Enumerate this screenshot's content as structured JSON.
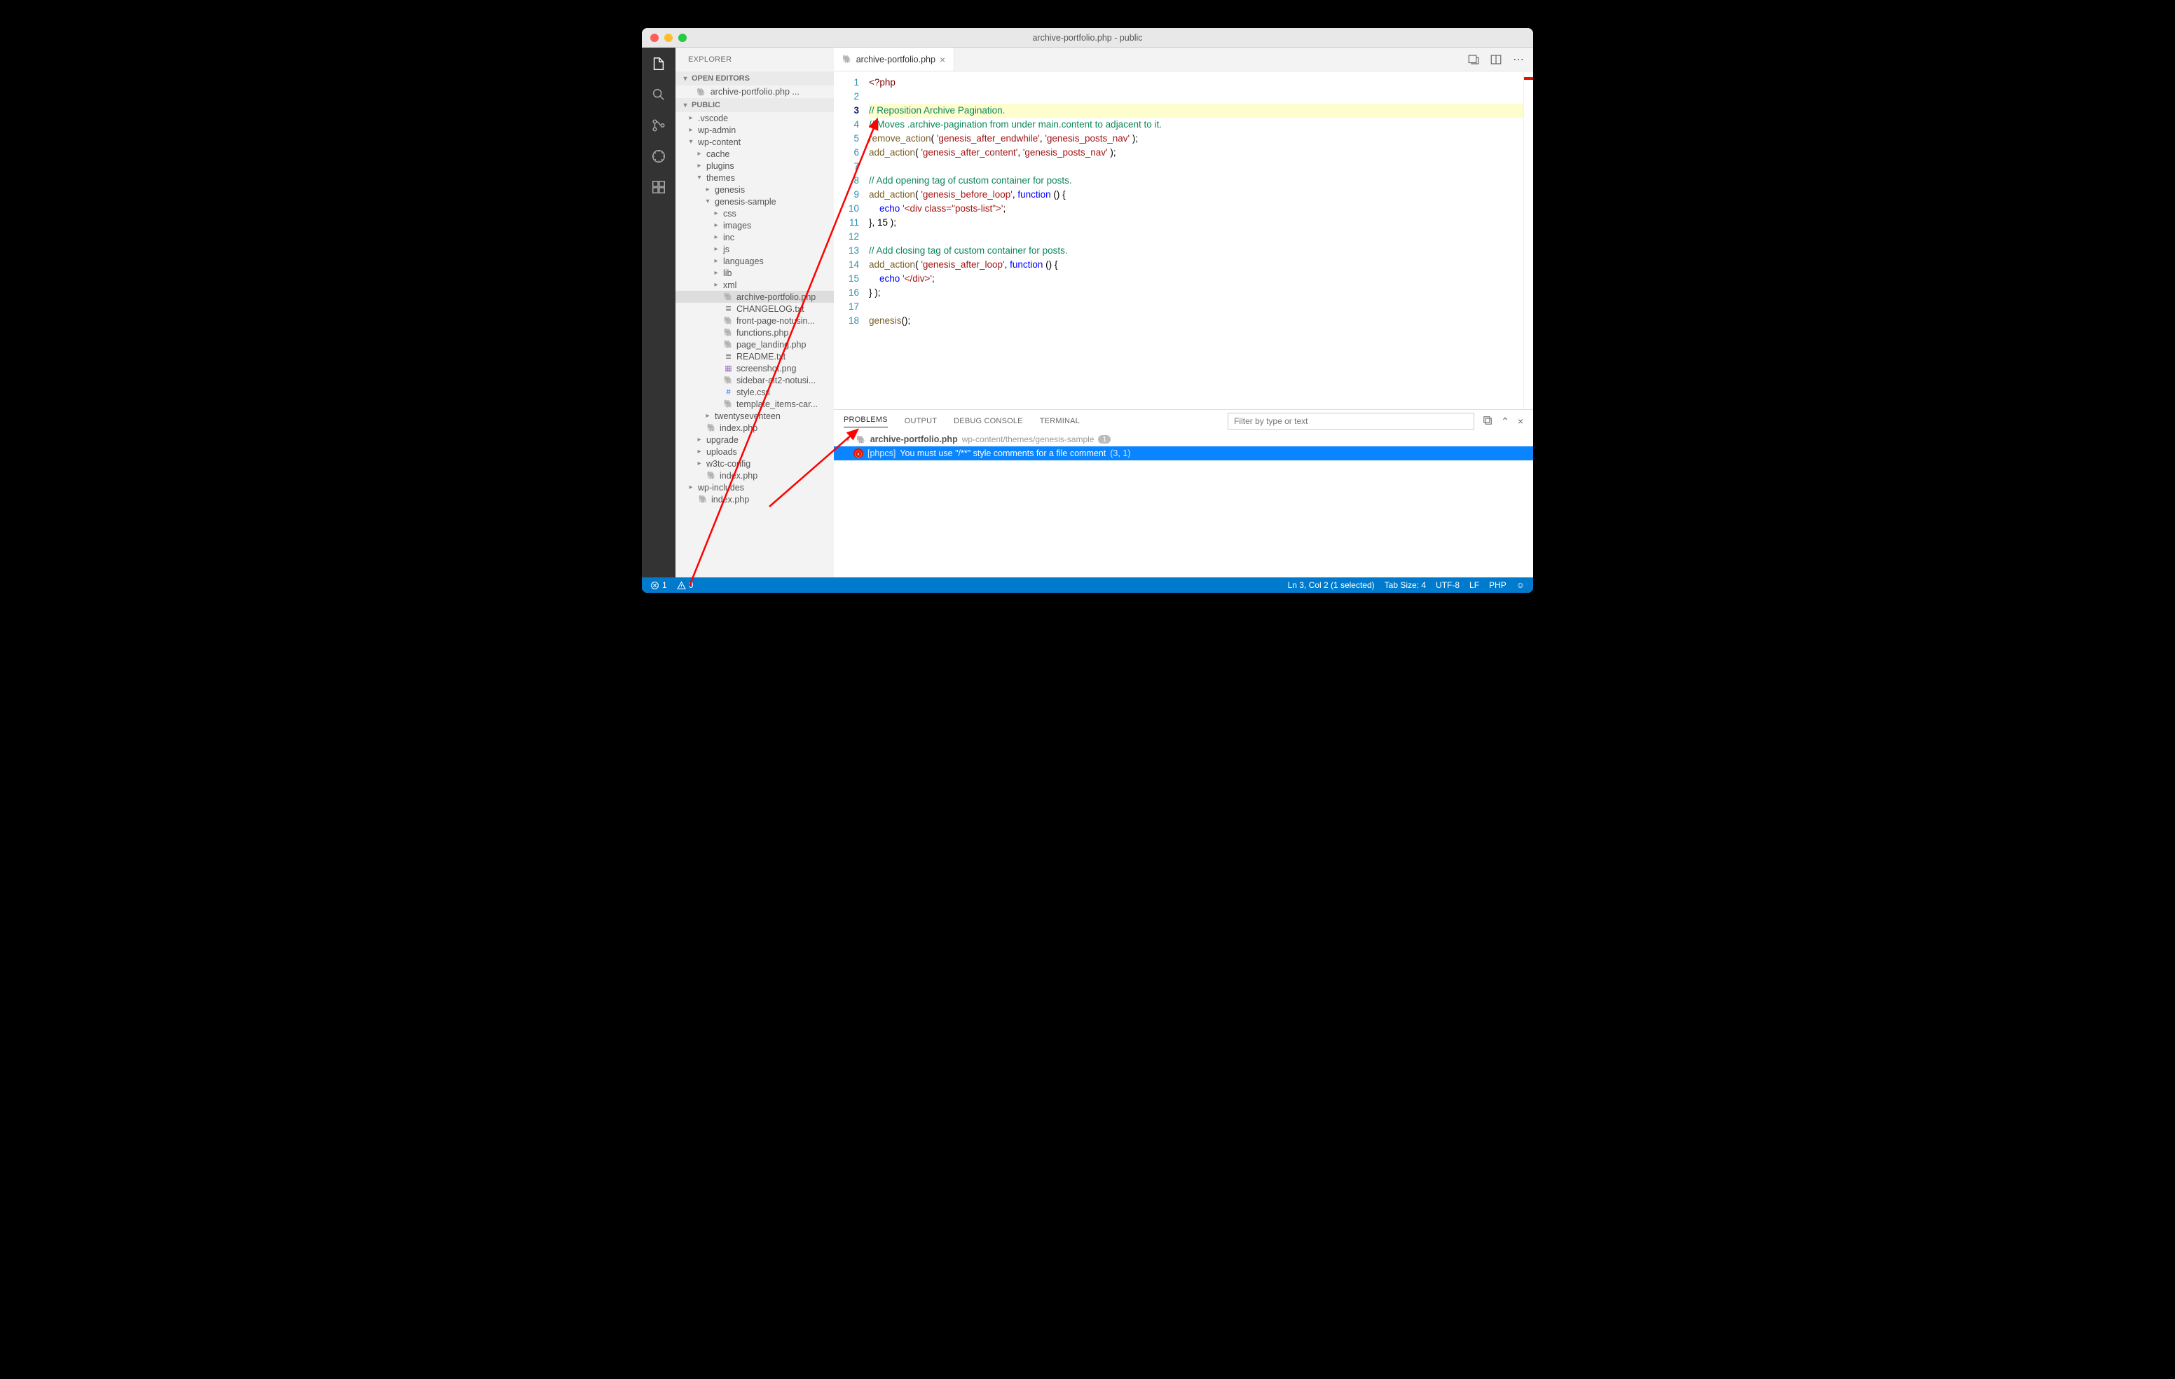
{
  "title": "archive-portfolio.php - public",
  "sidebar_title": "EXPLORER",
  "sections": {
    "open_editors": "OPEN EDITORS",
    "public": "PUBLIC"
  },
  "open_editor": "archive-portfolio.php ...",
  "tree": [
    {
      "d": 1,
      "t": "c",
      "l": ".vscode"
    },
    {
      "d": 1,
      "t": "c",
      "l": "wp-admin"
    },
    {
      "d": 1,
      "t": "o",
      "l": "wp-content"
    },
    {
      "d": 2,
      "t": "c",
      "l": "cache"
    },
    {
      "d": 2,
      "t": "c",
      "l": "plugins"
    },
    {
      "d": 2,
      "t": "o",
      "l": "themes"
    },
    {
      "d": 3,
      "t": "c",
      "l": "genesis"
    },
    {
      "d": 3,
      "t": "o",
      "l": "genesis-sample"
    },
    {
      "d": 4,
      "t": "c",
      "l": "css"
    },
    {
      "d": 4,
      "t": "c",
      "l": "images"
    },
    {
      "d": 4,
      "t": "c",
      "l": "inc"
    },
    {
      "d": 4,
      "t": "c",
      "l": "js"
    },
    {
      "d": 4,
      "t": "c",
      "l": "languages"
    },
    {
      "d": 4,
      "t": "c",
      "l": "lib"
    },
    {
      "d": 4,
      "t": "c",
      "l": "xml"
    },
    {
      "d": 4,
      "t": "f",
      "i": "php",
      "l": "archive-portfolio.php",
      "sel": true
    },
    {
      "d": 4,
      "t": "f",
      "i": "txt",
      "l": "CHANGELOG.txt"
    },
    {
      "d": 4,
      "t": "f",
      "i": "php",
      "l": "front-page-notusin..."
    },
    {
      "d": 4,
      "t": "f",
      "i": "php",
      "l": "functions.php"
    },
    {
      "d": 4,
      "t": "f",
      "i": "php",
      "l": "page_landing.php"
    },
    {
      "d": 4,
      "t": "f",
      "i": "txt",
      "l": "README.txt"
    },
    {
      "d": 4,
      "t": "f",
      "i": "img",
      "l": "screenshot.png"
    },
    {
      "d": 4,
      "t": "f",
      "i": "php",
      "l": "sidebar-alt2-notusi..."
    },
    {
      "d": 4,
      "t": "f",
      "i": "css",
      "l": "style.css"
    },
    {
      "d": 4,
      "t": "f",
      "i": "php",
      "l": "template_items-car..."
    },
    {
      "d": 3,
      "t": "c",
      "l": "twentyseventeen"
    },
    {
      "d": 2,
      "t": "f",
      "i": "php",
      "l": "index.php"
    },
    {
      "d": 2,
      "t": "c",
      "l": "upgrade"
    },
    {
      "d": 2,
      "t": "c",
      "l": "uploads"
    },
    {
      "d": 2,
      "t": "c",
      "l": "w3tc-config"
    },
    {
      "d": 2,
      "t": "f",
      "i": "php",
      "l": "index.php"
    },
    {
      "d": 1,
      "t": "c",
      "l": "wp-includes"
    },
    {
      "d": 1,
      "t": "f",
      "i": "php",
      "l": "index.php"
    }
  ],
  "tab": "archive-portfolio.php",
  "code_lines": [
    "<?php",
    "",
    "// Reposition Archive Pagination.",
    "// Moves .archive-pagination from under main.content to adjacent to it.",
    "remove_action( 'genesis_after_endwhile', 'genesis_posts_nav' );",
    "add_action( 'genesis_after_content', 'genesis_posts_nav' );",
    "",
    "// Add opening tag of custom container for posts.",
    "add_action( 'genesis_before_loop', function () {",
    "    echo '<div class=\"posts-list\">';",
    "}, 15 );",
    "",
    "// Add closing tag of custom container for posts.",
    "add_action( 'genesis_after_loop', function () {",
    "    echo '</div>';",
    "} );",
    "",
    "genesis();"
  ],
  "highlighted_line": 3,
  "panel_tabs": [
    "PROBLEMS",
    "OUTPUT",
    "DEBUG CONSOLE",
    "TERMINAL"
  ],
  "filter_placeholder": "Filter by type or text",
  "problem_file": {
    "name": "archive-portfolio.php",
    "path": "wp-content/themes/genesis-sample",
    "count": "1"
  },
  "problem_item": {
    "source": "[phpcs]",
    "msg": "You must use \"/**\" style comments for a file comment",
    "loc": "(3, 1)"
  },
  "status": {
    "errors": "1",
    "warnings": "0",
    "cursor": "Ln 3, Col 2 (1 selected)",
    "tab": "Tab Size: 4",
    "enc": "UTF-8",
    "eol": "LF",
    "lang": "PHP"
  }
}
